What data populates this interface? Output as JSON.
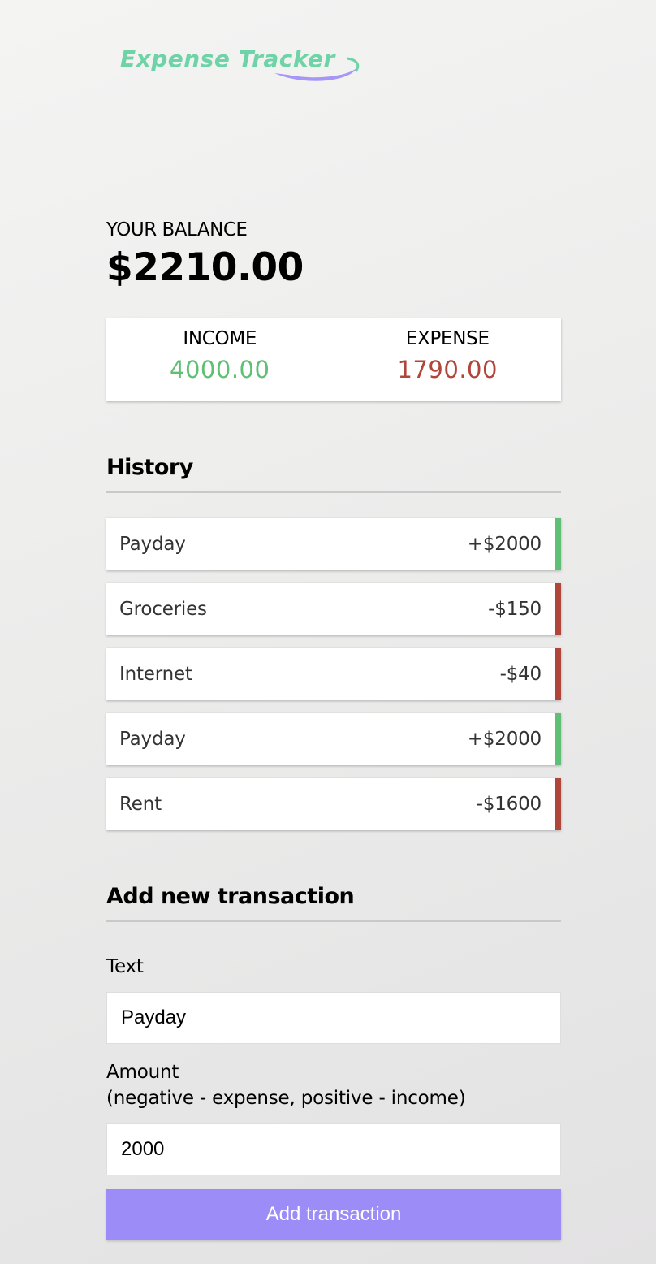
{
  "header": {
    "logo_text": "Expense Tracker",
    "colors": {
      "logo_green": "#6fd3a8",
      "logo_swoosh": "#9c8cf7"
    }
  },
  "balance": {
    "label": "YOUR BALANCE",
    "value": "$2210.00"
  },
  "summary": {
    "income_label": "INCOME",
    "income_value": "4000.00",
    "expense_label": "EXPENSE",
    "expense_value": "1790.00",
    "colors": {
      "income": "#5fbf74",
      "expense": "#b0453a"
    }
  },
  "history": {
    "title": "History",
    "items": [
      {
        "text": "Payday",
        "amount": "+$2000",
        "type": "plus"
      },
      {
        "text": "Groceries",
        "amount": "-$150",
        "type": "minus"
      },
      {
        "text": "Internet",
        "amount": "-$40",
        "type": "minus"
      },
      {
        "text": "Payday",
        "amount": "+$2000",
        "type": "plus"
      },
      {
        "text": "Rent",
        "amount": "-$1600",
        "type": "minus"
      }
    ]
  },
  "form": {
    "title": "Add new transaction",
    "text_label": "Text",
    "text_value": "Payday",
    "amount_label": "Amount",
    "amount_hint": "(negative - expense, positive - income)",
    "amount_value": "2000",
    "submit_label": "Add transaction",
    "colors": {
      "button": "#9c8cf7"
    }
  }
}
